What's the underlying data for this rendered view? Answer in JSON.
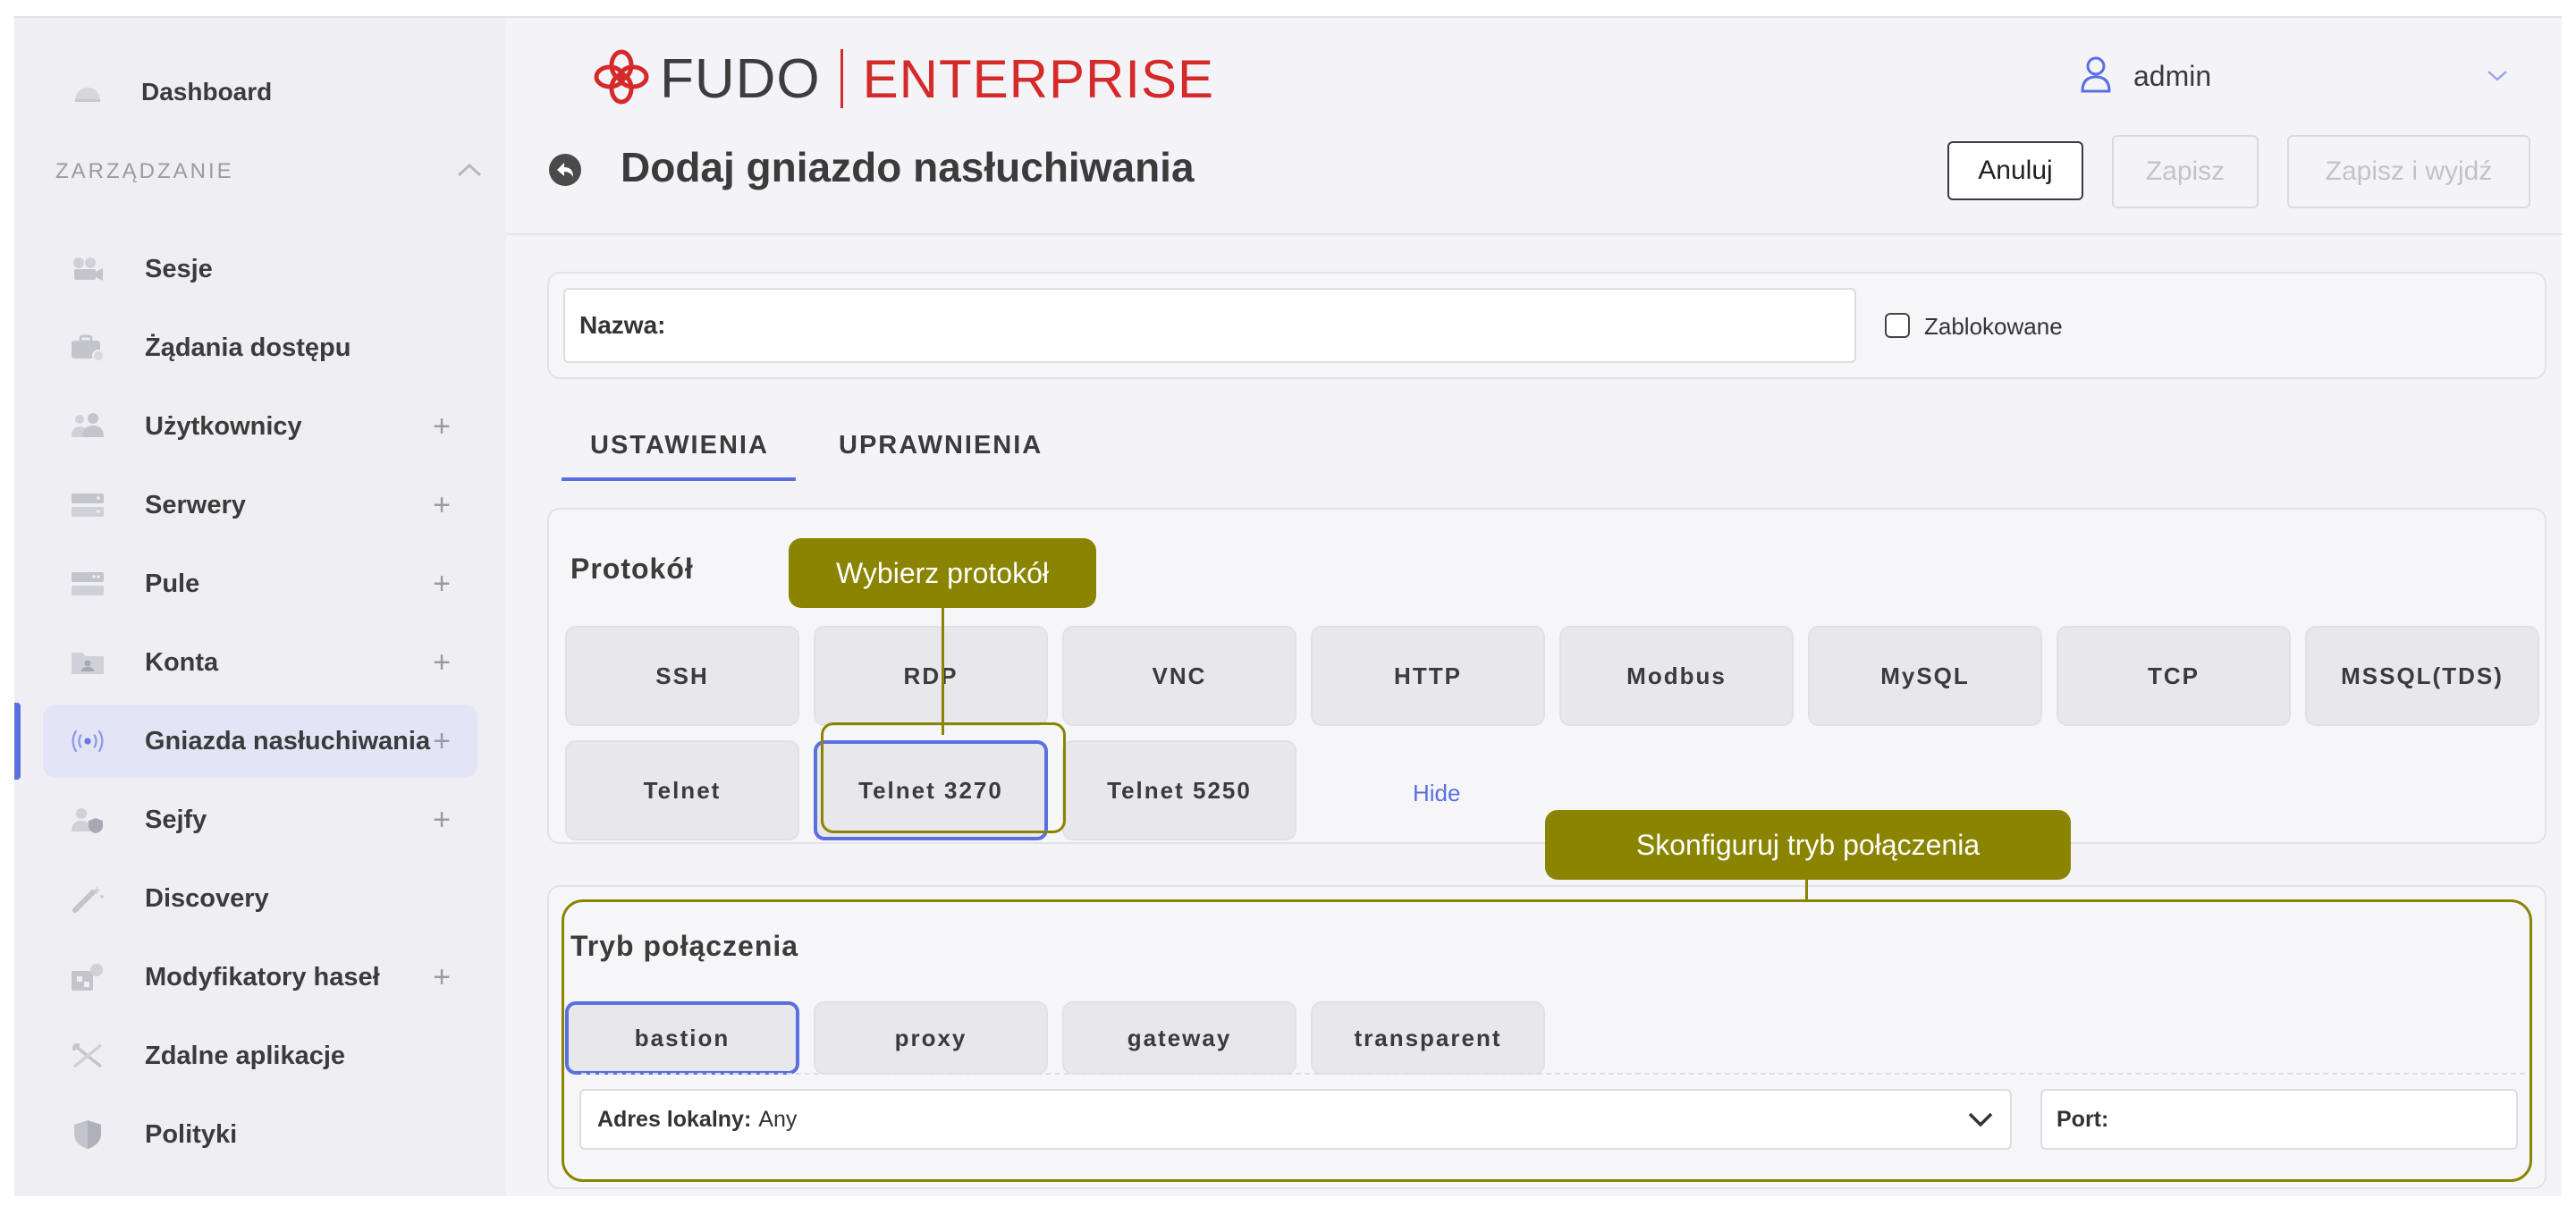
{
  "sidebar": {
    "dashboard": "Dashboard",
    "section": "ZARZĄDZANIE",
    "items": [
      {
        "label": "Sesje",
        "icon": "video-camera-icon",
        "plus": false
      },
      {
        "label": "Żądania dostępu",
        "icon": "briefcase-icon",
        "plus": false
      },
      {
        "label": "Użytkownicy",
        "icon": "users-icon",
        "plus": true
      },
      {
        "label": "Serwery",
        "icon": "server-icon",
        "plus": true
      },
      {
        "label": "Pule",
        "icon": "server-pool-icon",
        "plus": true
      },
      {
        "label": "Konta",
        "icon": "account-folder-icon",
        "plus": true
      },
      {
        "label": "Gniazda nasłuchiwania",
        "icon": "listener-icon",
        "plus": true,
        "active": true
      },
      {
        "label": "Sejfy",
        "icon": "safe-icon",
        "plus": true
      },
      {
        "label": "Discovery",
        "icon": "magic-wand-icon",
        "plus": false
      },
      {
        "label": "Modyfikatory haseł",
        "icon": "password-modifier-icon",
        "plus": true
      },
      {
        "label": "Zdalne aplikacje",
        "icon": "remote-app-icon",
        "plus": false
      },
      {
        "label": "Polityki",
        "icon": "shield-icon",
        "plus": false
      }
    ],
    "plus_symbol": "+"
  },
  "header": {
    "logo_fudo": "FUDO",
    "logo_enterprise": "ENTERPRISE",
    "user": "admin",
    "page_title": "Dodaj gniazdo nasłuchiwania",
    "cancel": "Anuluj",
    "save": "Zapisz",
    "save_exit": "Zapisz i wyjdź"
  },
  "form": {
    "name_label": "Nazwa:",
    "blocked_label": "Zablokowane",
    "tabs": [
      "USTAWIENIA",
      "UPRAWNIENIA"
    ]
  },
  "protocol": {
    "title": "Protokół",
    "buttons": [
      "SSH",
      "RDP",
      "VNC",
      "HTTP",
      "Modbus",
      "MySQL",
      "TCP",
      "MSSQL(TDS)",
      "Telnet",
      "Telnet 3270",
      "Telnet 5250"
    ],
    "selected": "Telnet 3270",
    "hide": "Hide"
  },
  "callouts": {
    "protocol": "Wybierz protokół",
    "mode": "Skonfiguruj tryb połączenia"
  },
  "mode": {
    "title": "Tryb połączenia",
    "buttons": [
      "bastion",
      "proxy",
      "gateway",
      "transparent"
    ],
    "selected": "bastion",
    "local_address_label": "Adres lokalny:",
    "local_address_value": "Any",
    "port_label": "Port:"
  },
  "colors": {
    "accent": "#5a6fe0",
    "brand_red": "#d42a2a",
    "callout": "#8a8400"
  }
}
